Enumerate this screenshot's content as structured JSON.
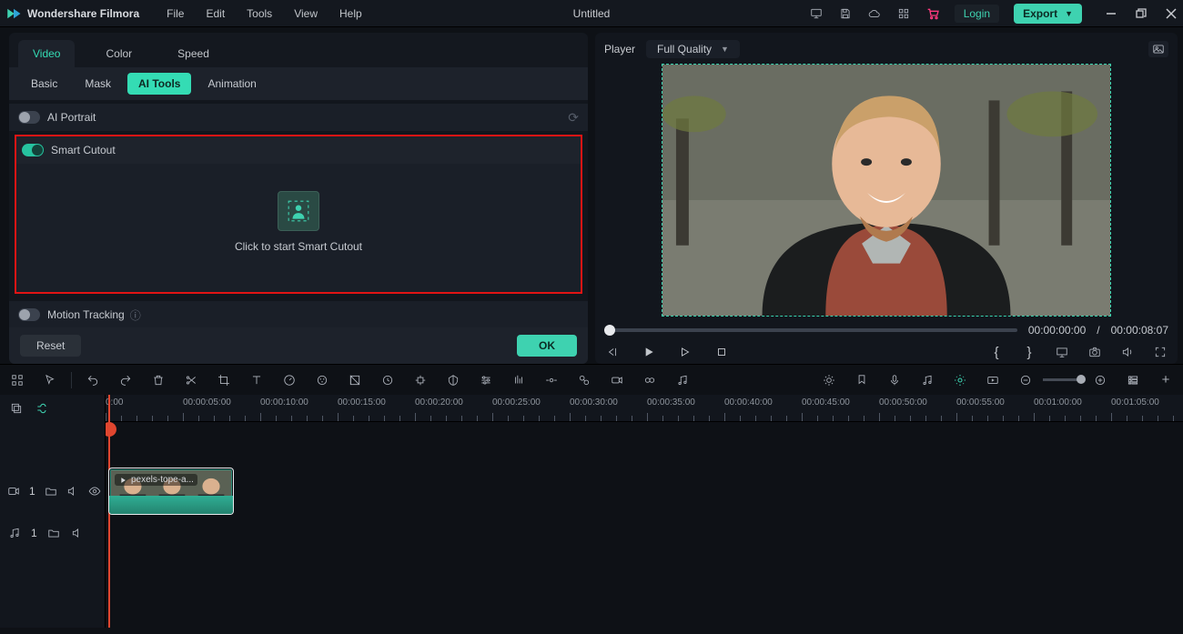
{
  "app": {
    "name": "Wondershare Filmora",
    "doc": "Untitled"
  },
  "menu": [
    "File",
    "Edit",
    "Tools",
    "View",
    "Help"
  ],
  "header": {
    "login": "Login",
    "export": "Export"
  },
  "tabs_main": [
    {
      "label": "Video",
      "active": true
    },
    {
      "label": "Color",
      "active": false
    },
    {
      "label": "Speed",
      "active": false
    }
  ],
  "tabs_sub": [
    {
      "label": "Basic",
      "active": false
    },
    {
      "label": "Mask",
      "active": false
    },
    {
      "label": "AI Tools",
      "active": true
    },
    {
      "label": "Animation",
      "active": false
    }
  ],
  "sections": {
    "ai_portrait": "AI Portrait",
    "smart_cutout": "Smart Cutout",
    "smart_cutout_click": "Click to start Smart Cutout",
    "motion_tracking": "Motion Tracking"
  },
  "buttons": {
    "reset": "Reset",
    "ok": "OK"
  },
  "player": {
    "label": "Player",
    "quality": "Full Quality",
    "current": "00:00:00:00",
    "sep": "/",
    "duration": "00:00:08:07"
  },
  "ruler": [
    "0:00",
    "00:00:05:00",
    "00:00:10:00",
    "00:00:15:00",
    "00:00:20:00",
    "00:00:25:00",
    "00:00:30:00",
    "00:00:35:00",
    "00:00:40:00",
    "00:00:45:00",
    "00:00:50:00",
    "00:00:55:00",
    "00:01:00:00",
    "00:01:05:00"
  ],
  "tracks": {
    "video_index": "1",
    "audio_index": "1",
    "clip_name": "pexels-tope-a..."
  }
}
